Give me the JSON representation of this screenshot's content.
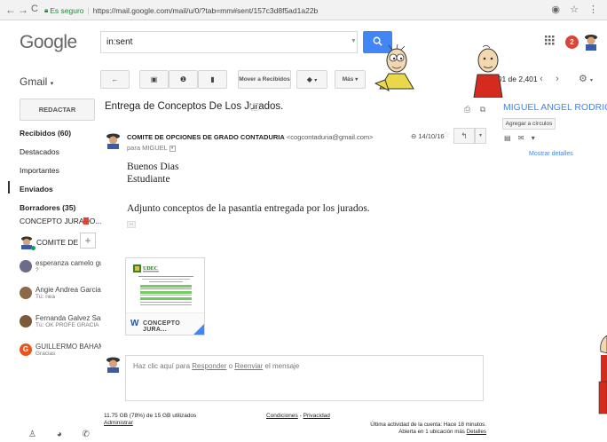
{
  "browser": {
    "back": "←",
    "forward": "→",
    "reload": "C",
    "secure_label": "Es seguro",
    "url": "https://mail.google.com/mail/u/0/?tab=mm#sent/157c3d8f5ad1a22b",
    "right_icons": "◉ ☆ ⋮"
  },
  "header": {
    "logo": "Google",
    "search_value": "in:sent",
    "search_icon": "search-icon",
    "apps_icon": "apps-icon",
    "notification_count": "2"
  },
  "toolbar": {
    "gmail_menu": "Gmail",
    "back_glyph": "←",
    "archive_glyph": "▣",
    "spam_glyph": "❶",
    "delete_glyph": "▮",
    "move_label": "Mover a Recibidos",
    "labels_glyph": "◆",
    "more_label": "Más",
    "pager": "301 de 2,401",
    "prev": "‹",
    "next": "›",
    "settings_glyph": "⚙"
  },
  "sidebar": {
    "compose": "REDACTAR",
    "items": [
      {
        "label": "Recibidos (60)",
        "bold": true
      },
      {
        "label": "Destacados",
        "bold": false
      },
      {
        "label": "Importantes",
        "bold": false
      },
      {
        "label": "Enviados",
        "bold": true
      },
      {
        "label": "Borradores (35)",
        "bold": true
      }
    ],
    "label_tag": "CONCEPTO JURADO...",
    "hangout_me": "COMITE DE OF",
    "add_contact": "+",
    "contacts": [
      {
        "name": "esperanza camelo gu",
        "msg": "?"
      },
      {
        "name": "Angie Andrea Garcia",
        "msg": "Tú: nea"
      },
      {
        "name": "Fernanda Galvez Sal",
        "msg": "Tú: OK PROFE GRACIA"
      },
      {
        "name": "GUILLERMO BAHAM",
        "msg": "Gracias",
        "initial": "G"
      }
    ],
    "bottom_icons": "♙ ◕ ✆"
  },
  "message": {
    "subject": "Entrega de Conceptos De Los Jurados.",
    "sender_name": "COMITE DE OPCIONES DE GRADO CONTADURIA",
    "sender_email": "<cogcontaduria@gmail.com>",
    "to": "para MIGUEL",
    "date": "14/10/16",
    "star": "☆",
    "reply_glyph": "↰",
    "more_glyph": "▾",
    "print_icons": "⎙ ⧉",
    "body_lines": [
      "Buenos Dias",
      "Estudiante",
      "Adjunto conceptos de la pasantia entregada por los jurados."
    ],
    "trimmed": "...",
    "attachment": {
      "name": "CONCEPTO JURA...",
      "icon": "W",
      "doc_title": "UDEC"
    },
    "reply_placeholder_pre": "Haz clic aquí para ",
    "reply_link": "Responder",
    "reply_mid": " o ",
    "forward_link": "Reenviar",
    "reply_post": " el mensaje"
  },
  "footer": {
    "storage": "11.75 GB (78%) de 15 GB utilizados",
    "manage": "Administrar",
    "terms": "Condiciones",
    "sep": " - ",
    "privacy": "Privacidad",
    "activity_1": "Última actividad de la cuenta: Hace 18 minutos.",
    "activity_2": "Abierta en 1 ubicación más",
    "details": "Detalles"
  },
  "right_panel": {
    "name": "MIGUEL ANGEL RODRIG...",
    "add_circles": "Agregar a círculos",
    "icons": "▤ ✉ ▾",
    "details": "Mostrar detalles"
  },
  "colors": {
    "google_blue": "#4285f4",
    "red": "#db4437",
    "secure_green": "#1a8a3a"
  }
}
